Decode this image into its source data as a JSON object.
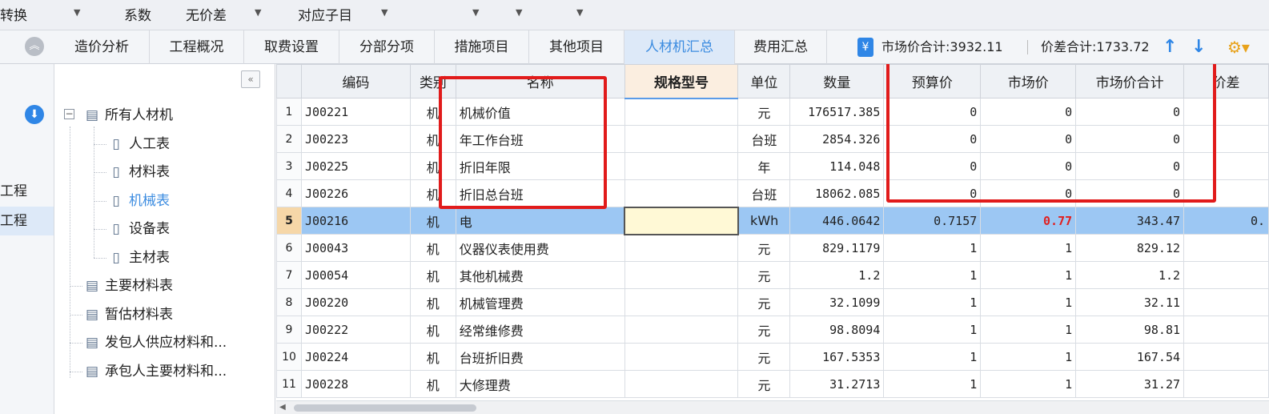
{
  "toolbar": {
    "items": [
      "转换",
      "系数",
      "无价差",
      "对应子目"
    ]
  },
  "tabs": [
    {
      "label": "造价分析",
      "active": false
    },
    {
      "label": "工程概况",
      "active": false
    },
    {
      "label": "取费设置",
      "active": false
    },
    {
      "label": "分部分项",
      "active": false
    },
    {
      "label": "措施项目",
      "active": false
    },
    {
      "label": "其他项目",
      "active": false
    },
    {
      "label": "人材机汇总",
      "active": true
    },
    {
      "label": "费用汇总",
      "active": false
    }
  ],
  "summary": {
    "market_total": "市场价合计:3932.11",
    "diff_total": "价差合计:1733.72"
  },
  "left_panel": {
    "items": [
      "工程",
      "工程"
    ]
  },
  "tree": {
    "root": "所有人材机",
    "children": [
      "人工表",
      "材料表",
      "机械表",
      "设备表",
      "主材表"
    ],
    "others": [
      "主要材料表",
      "暂估材料表",
      "发包人供应材料和...",
      "承包人主要材料和..."
    ]
  },
  "grid": {
    "headers": [
      "",
      "编码",
      "类别",
      "名称",
      "规格型号",
      "单位",
      "数量",
      "预算价",
      "市场价",
      "市场价合计",
      "价差"
    ],
    "rows": [
      {
        "idx": "1",
        "code": "J00221",
        "type": "机",
        "name": "机械价值",
        "spec": "",
        "unit": "元",
        "qty": "176517.385",
        "budget": "0",
        "market": "0",
        "market_total": "0",
        "diff": ""
      },
      {
        "idx": "2",
        "code": "J00223",
        "type": "机",
        "name": "年工作台班",
        "spec": "",
        "unit": "台班",
        "qty": "2854.326",
        "budget": "0",
        "market": "0",
        "market_total": "0",
        "diff": ""
      },
      {
        "idx": "3",
        "code": "J00225",
        "type": "机",
        "name": "折旧年限",
        "spec": "",
        "unit": "年",
        "qty": "114.048",
        "budget": "0",
        "market": "0",
        "market_total": "0",
        "diff": ""
      },
      {
        "idx": "4",
        "code": "J00226",
        "type": "机",
        "name": "折旧总台班",
        "spec": "",
        "unit": "台班",
        "qty": "18062.085",
        "budget": "0",
        "market": "0",
        "market_total": "0",
        "diff": ""
      },
      {
        "idx": "5",
        "code": "J00216",
        "type": "机",
        "name": "电",
        "spec": "",
        "unit": "kWh",
        "qty": "446.0642",
        "budget": "0.7157",
        "market": "0.77",
        "market_total": "343.47",
        "diff": "0."
      },
      {
        "idx": "6",
        "code": "J00043",
        "type": "机",
        "name": "仪器仪表使用费",
        "spec": "",
        "unit": "元",
        "qty": "829.1179",
        "budget": "1",
        "market": "1",
        "market_total": "829.12",
        "diff": ""
      },
      {
        "idx": "7",
        "code": "J00054",
        "type": "机",
        "name": "其他机械费",
        "spec": "",
        "unit": "元",
        "qty": "1.2",
        "budget": "1",
        "market": "1",
        "market_total": "1.2",
        "diff": ""
      },
      {
        "idx": "8",
        "code": "J00220",
        "type": "机",
        "name": "机械管理费",
        "spec": "",
        "unit": "元",
        "qty": "32.1099",
        "budget": "1",
        "market": "1",
        "market_total": "32.11",
        "diff": ""
      },
      {
        "idx": "9",
        "code": "J00222",
        "type": "机",
        "name": "经常维修费",
        "spec": "",
        "unit": "元",
        "qty": "98.8094",
        "budget": "1",
        "market": "1",
        "market_total": "98.81",
        "diff": ""
      },
      {
        "idx": "10",
        "code": "J00224",
        "type": "机",
        "name": "台班折旧费",
        "spec": "",
        "unit": "元",
        "qty": "167.5353",
        "budget": "1",
        "market": "1",
        "market_total": "167.54",
        "diff": ""
      },
      {
        "idx": "11",
        "code": "J00228",
        "type": "机",
        "name": "大修理费",
        "spec": "",
        "unit": "元",
        "qty": "31.2713",
        "budget": "1",
        "market": "1",
        "market_total": "31.27",
        "diff": ""
      }
    ]
  },
  "colors": {
    "accent": "#3c8ce0",
    "selected_row": "#9cc7f3",
    "annotation": "#e11b1b",
    "highlight_price": "#e02020"
  }
}
